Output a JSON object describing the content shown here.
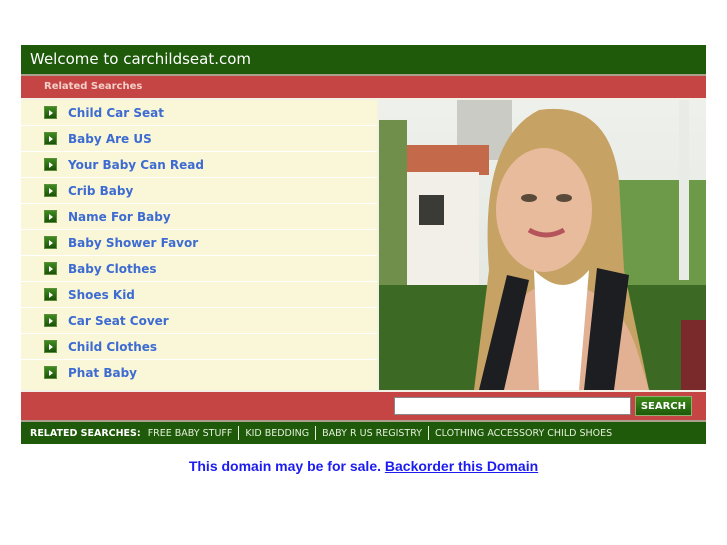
{
  "header": {
    "title": "Welcome to carchildseat.com"
  },
  "related_bar": {
    "label": "Related Searches"
  },
  "links": [
    "Child Car Seat",
    "Baby Are US",
    "Your Baby Can Read",
    "Crib Baby",
    "Name For Baby",
    "Baby Shower Favor",
    "Baby Clothes",
    "Shoes Kid",
    "Car Seat Cover",
    "Child Clothes",
    "Phat Baby"
  ],
  "photo": {
    "description": "Smiling young woman with blonde hair wearing a backpack, outdoor campus background"
  },
  "search": {
    "value": "",
    "button_label": "SEARCH"
  },
  "bottom_related": {
    "label": "RELATED SEARCHES:",
    "items": [
      "FREE BABY STUFF",
      "KID BEDDING",
      "BABY R US REGISTRY",
      "CLOTHING ACCESSORY CHILD SHOES"
    ]
  },
  "sale": {
    "text": "This domain may be for sale.",
    "link": "Backorder this Domain"
  },
  "colors": {
    "header_green": "#1e5a0a",
    "bar_red": "#c54545",
    "list_bg": "#f9f7d8",
    "link_blue": "#3d6bd1",
    "sale_blue": "#1c1cf0"
  }
}
